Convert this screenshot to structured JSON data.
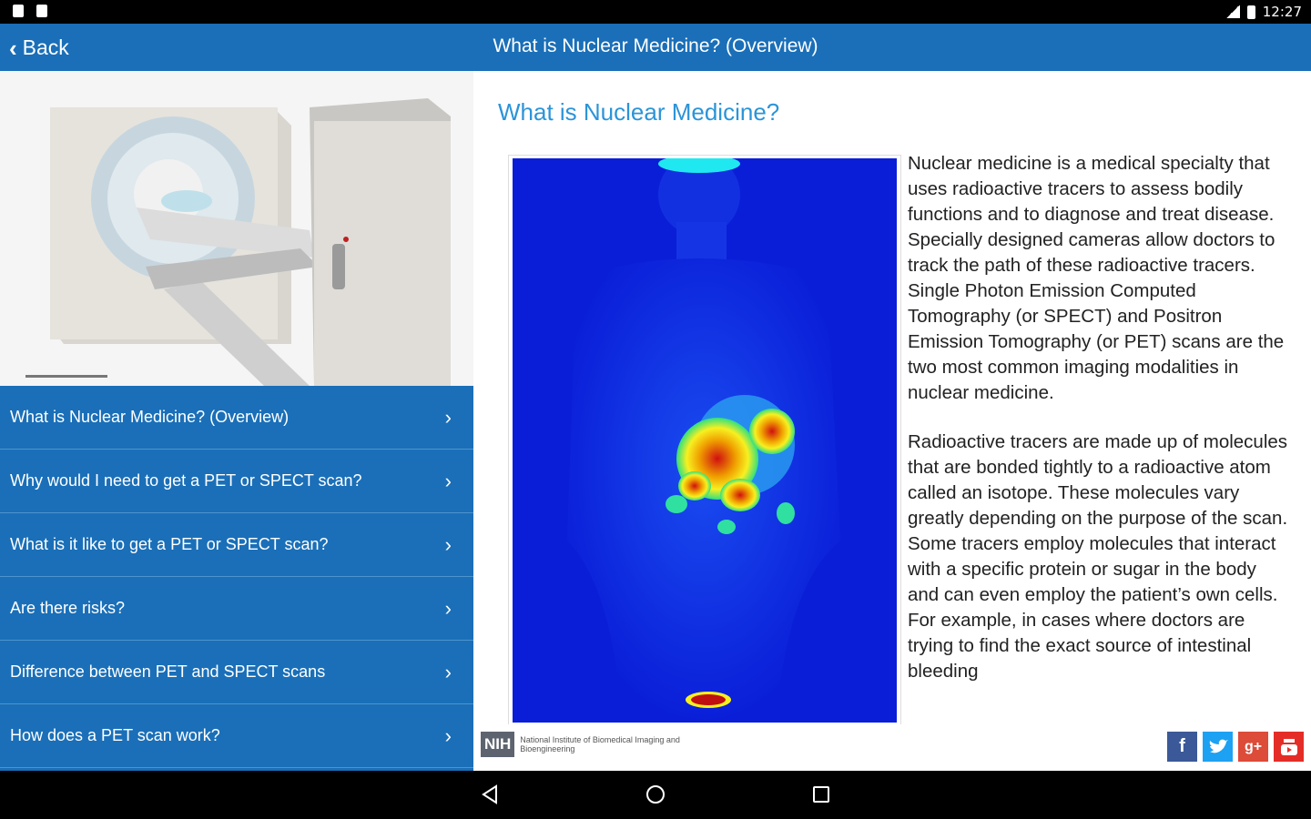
{
  "status_bar": {
    "time": "12:27"
  },
  "app_bar": {
    "back_label": "Back",
    "title": "What is Nuclear Medicine? (Overview)"
  },
  "menu": {
    "items": [
      {
        "label": "What is Nuclear Medicine? (Overview)"
      },
      {
        "label": "Why would I need to get a PET or SPECT scan?"
      },
      {
        "label": "What is it like to get a PET or SPECT scan?"
      },
      {
        "label": "Are there risks?"
      },
      {
        "label": "Difference between PET and SPECT scans"
      },
      {
        "label": "How does a PET scan work?"
      }
    ]
  },
  "content": {
    "title": "What is Nuclear Medicine?",
    "paragraphs": [
      "Nuclear medicine is a medical specialty that uses radioactive tracers to assess bodily functions and to diagnose and treat disease. Specially designed cameras allow doctors to track the path of these radioactive tracers. Single Photon Emission Computed Tomography (or SPECT) and Positron Emission Tomography (or PET) scans are the two most common imaging modalities in nuclear medicine.",
      "Radioactive tracers are made up of molecules that are bonded tightly to a radioactive atom called an isotope. These molecules vary greatly depending on the purpose of the scan. Some tracers employ molecules that interact with a specific protein or sugar in the body and can even employ the patient’s own cells. For example, in cases where doctors are trying to find the exact source of intestinal bleeding"
    ]
  },
  "footer": {
    "nih_badge": "NIH",
    "institute_name": "National Institute of Biomedical Imaging and Bioengineering",
    "social_icons": [
      "facebook-icon",
      "twitter-icon",
      "google-plus-icon",
      "youtube-icon"
    ]
  },
  "colors": {
    "primary": "#1a6fb8",
    "accent_title": "#2b94d8",
    "menu_divider": "#4f94cd"
  }
}
